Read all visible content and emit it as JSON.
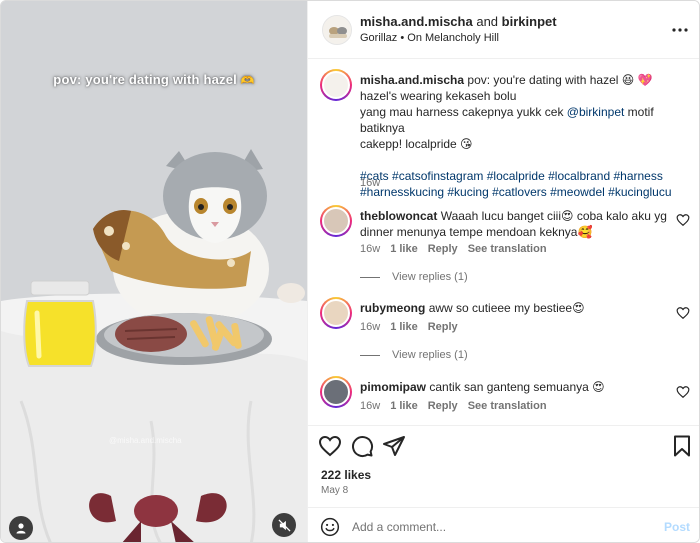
{
  "media": {
    "overlay_text": "pov: you're dating with hazel",
    "overlay_emoji": "🫶",
    "watermark": "@misha.and.mischa"
  },
  "header": {
    "username": "misha.and.mischa",
    "connector": "and",
    "collaborator": "birkinpet",
    "artist": "Gorillaz",
    "separator": "•",
    "song": "On Melancholy Hill"
  },
  "caption": {
    "username": "misha.and.mischa",
    "line1": "pov: you're dating with hazel 😆 💖",
    "line2": "hazel's wearing kekaseh bolu",
    "line3_pre": "yang mau harness cakepnya yukk cek ",
    "line3_mention": "@birkinpet",
    "line3_post": " motif batiknya",
    "line4": "cakepp! localpride 😘",
    "hashtags_line1": "#cats #catsofinstagram #localpride #localbrand #harness",
    "hashtags_line2": "#harnesskucing #kucing #catlovers #meowdel #kucinglucu",
    "time": "16w"
  },
  "comments": [
    {
      "username": "theblowoncat",
      "text": "Waaah lucu banget ciii😍 coba kalo aku yg dinner menunya tempe mendoan keknya🥰",
      "time": "16w",
      "likes": "1 like",
      "reply": "Reply",
      "translate": "See translation",
      "view_replies": "View replies (1)"
    },
    {
      "username": "rubymeong",
      "text": "aww so cutieee my bestiee😍",
      "time": "16w",
      "likes": "1 like",
      "reply": "Reply",
      "view_replies": "View replies (1)"
    },
    {
      "username": "pimomipaw",
      "text": "cantik san ganteng semuanya 😍",
      "time": "16w",
      "likes": "1 like",
      "reply": "Reply",
      "translate": "See translation"
    }
  ],
  "footer": {
    "likes": "222 likes",
    "date": "May 8",
    "comment_placeholder": "Add a comment...",
    "post_label": "Post"
  },
  "colors": {
    "link": "#00376b",
    "muted": "#737373",
    "post_disabled": "#b3dbff"
  },
  "icons": [
    "user-icon",
    "mute-icon",
    "more-icon",
    "heart-icon",
    "comment-icon",
    "share-icon",
    "bookmark-icon",
    "emoji-icon"
  ]
}
